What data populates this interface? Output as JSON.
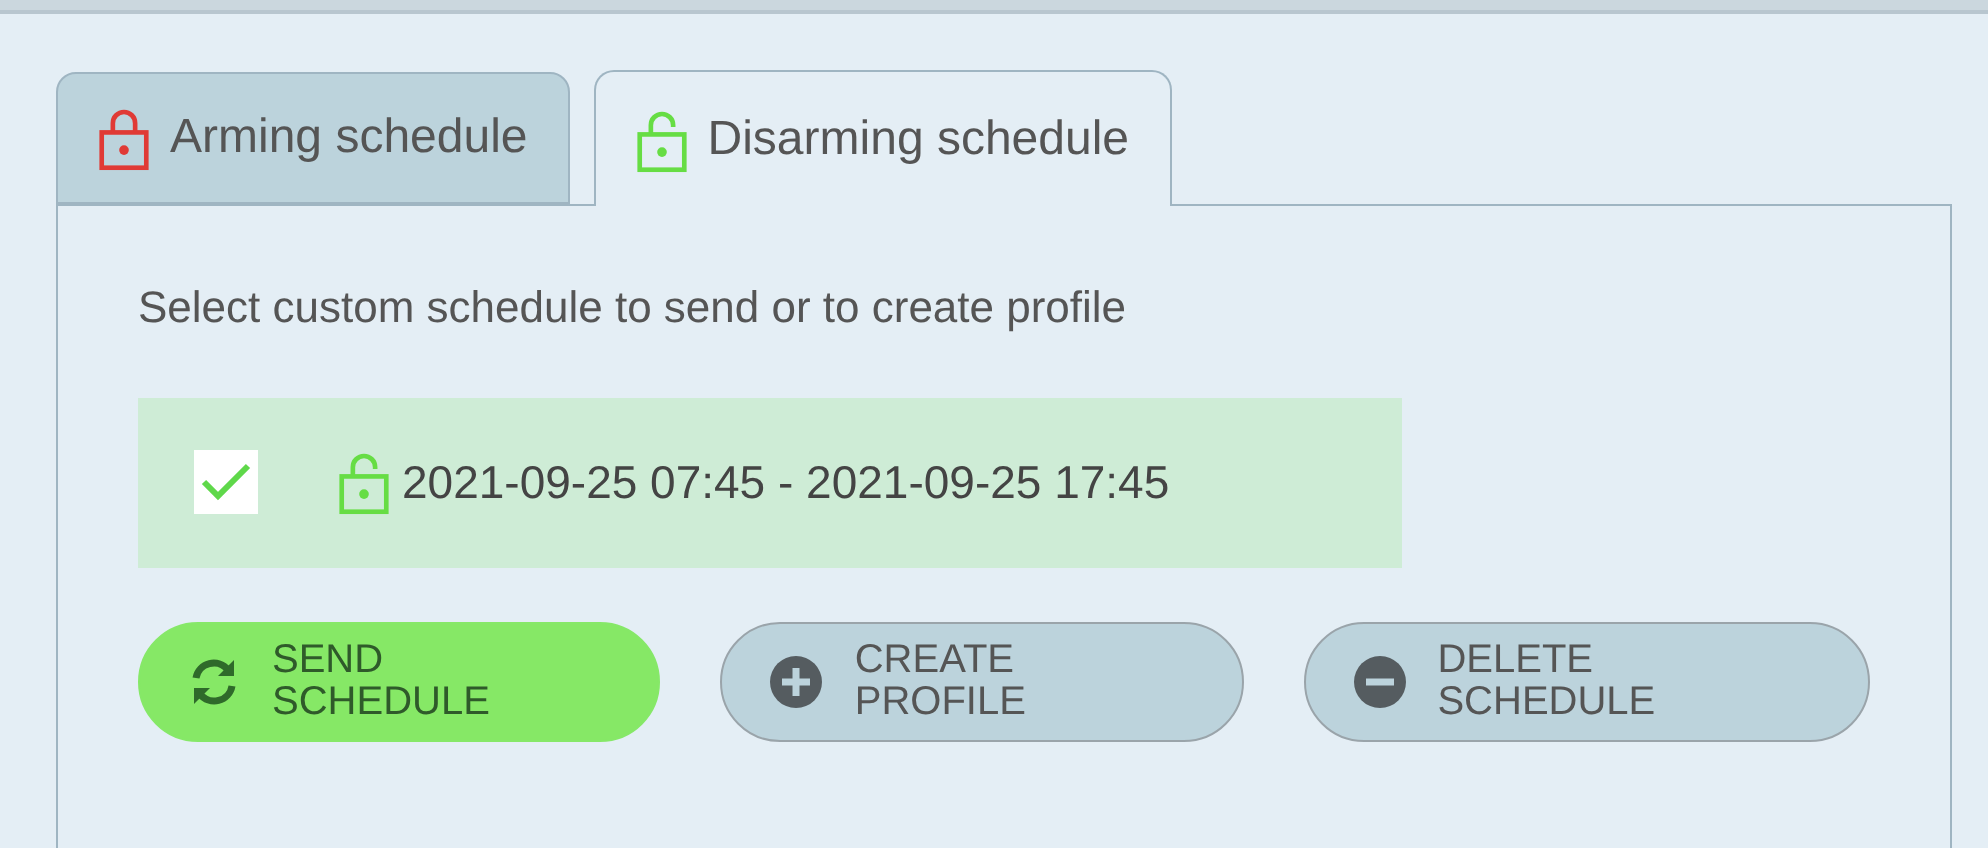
{
  "tabs": [
    {
      "label": "Arming schedule",
      "kind": "arming",
      "selected": false
    },
    {
      "label": "Disarming schedule",
      "kind": "disarming",
      "selected": true
    }
  ],
  "instruction": "Select custom schedule to send or to create profile",
  "schedules": [
    {
      "kind": "disarming",
      "range": "2021-09-25 07:45 - 2021-09-25 17:45",
      "checked": true,
      "selected": true
    }
  ],
  "buttons": [
    {
      "kind": "send",
      "label": "SEND SCHEDULE"
    },
    {
      "kind": "create",
      "label": "CREATE PROFILE"
    },
    {
      "kind": "delete",
      "label": "DELETE SCHEDULE"
    }
  ]
}
